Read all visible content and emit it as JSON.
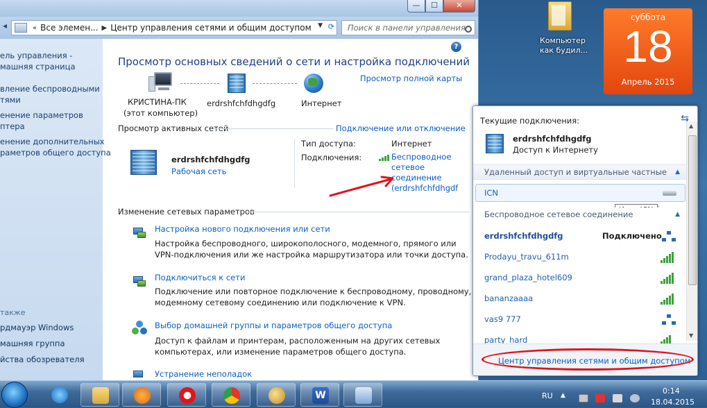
{
  "window": {
    "address": {
      "root": "Все элемен...",
      "current": "Центр управления сетями и общим доступом"
    },
    "search_placeholder": "Поиск в панели управления",
    "caption": {
      "min": "—",
      "max": "☐",
      "close": "✕"
    }
  },
  "sidebar": {
    "items": [
      "ель управления -",
      "машняя страница",
      "вление беспроводными",
      "тями",
      "енение параметров",
      "птера",
      "енение дополнительных",
      "раметров общего доступа"
    ],
    "see_also": "также",
    "links": [
      "рдмауэр Windows",
      "машняя группа",
      "йства обозревателя"
    ]
  },
  "main": {
    "title": "Просмотр основных сведений о сети и настройка подключений",
    "full_map_link": "Просмотр полной карты",
    "map": {
      "pc_name": "КРИСТИНА-ПК",
      "pc_note": "(этот компьютер)",
      "network": "erdrshfchfdhgdfg",
      "internet": "Интернет"
    },
    "active_header": "Просмотр активных сетей",
    "connect_link": "Подключение или отключение",
    "active": {
      "name": "erdrshfchfdhgdfg",
      "type": "Рабочая сеть",
      "access_label": "Тип доступа:",
      "access_value": "Интернет",
      "conn_label": "Подключения:",
      "conn_value": [
        "Беспроводное",
        "сетевое",
        "соединение",
        "(erdrshfchfdhgdf"
      ]
    },
    "change_header": "Изменение сетевых параметров",
    "tasks": [
      {
        "title": "Настройка нового подключения или сети",
        "desc": [
          "Настройка беспроводного, широкополосного, модемного, прямого или",
          "VPN-подключения или же настройка маршрутизатора или точки доступа."
        ]
      },
      {
        "title": "Подключиться к сети",
        "desc": [
          "Подключение или повторное подключение к беспроводному, проводному,",
          "модемному сетевому соединению или подключение к VPN."
        ]
      },
      {
        "title": "Выбор домашней группы и параметров общего доступа",
        "desc": [
          "Доступ к файлам и принтерам, расположенным на других сетевых",
          "компьютерах, или изменение параметров общего доступа."
        ]
      },
      {
        "title": "Устранение неполадок",
        "desc": []
      }
    ]
  },
  "popup": {
    "current_header": "Текущие подключения:",
    "conn_name": "erdrshfchfdhgdfg",
    "conn_status": "Доступ к Интернету",
    "vpn_header": "Удаленный доступ и виртуальные частные сети",
    "icn": "ICN",
    "tooltip": "Имя: ICN",
    "wireless_header": "Беспроводное сетевое соединение",
    "networks": [
      {
        "name": "erdrshfchfdhgdfg",
        "status": "Подключено",
        "icon": "network-connected-icon"
      },
      {
        "name": "Prodayu_travu_611m",
        "status": "",
        "icon": "signal-icon",
        "bars": 5
      },
      {
        "name": "grand_plaza_hotel609",
        "status": "",
        "icon": "signal-icon",
        "bars": 5
      },
      {
        "name": "bananzaaaa",
        "status": "",
        "icon": "signal-icon",
        "bars": 5
      },
      {
        "name": "vas9 777",
        "status": "",
        "icon": "network-adhoc-icon"
      },
      {
        "name": "party_hard",
        "status": "",
        "icon": "signal-icon",
        "bars": 4
      }
    ],
    "footer_link": "Центр управления сетями и общим доступом"
  },
  "desktop": {
    "shortcut_label": "Компьютер как будил...",
    "calendar": {
      "weekday": "суббота",
      "day": "18",
      "month": "Апрель 2015"
    }
  },
  "taskbar": {
    "lang": "RU",
    "time": "0:14",
    "date": "18.04.2015",
    "apps": [
      "ie-icon",
      "explorer-icon",
      "media-player-icon",
      "opera-icon",
      "chrome-icon",
      "paint-icon",
      "word-icon",
      "control-panel-icon"
    ]
  },
  "colors": {
    "link": "#0b5ec4",
    "annotation_red": "#e0141a",
    "calendar": "#f05a1a"
  }
}
